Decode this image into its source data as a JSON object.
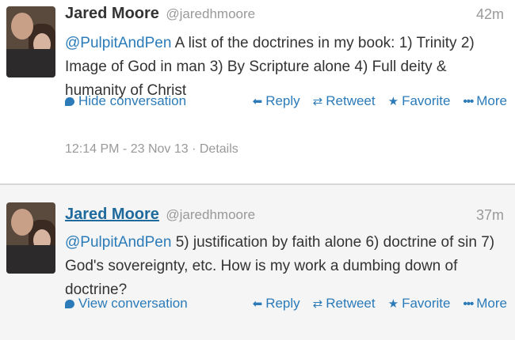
{
  "tweets": [
    {
      "name": "Jared Moore",
      "handle": "@jaredhmoore",
      "time": "42m",
      "mention": "@PulpitAndPen",
      "text": " A list of the doctrines in my book: 1) Trinity 2) Image of God in man 3) By Scripture alone 4) Full deity & humanity of Christ",
      "conversation_label": "Hide conversation",
      "reply_label": "Reply",
      "retweet_label": "Retweet",
      "favorite_label": "Favorite",
      "more_label": "More",
      "timestamp": "12:14 PM - 23 Nov 13",
      "details_label": "Details"
    },
    {
      "name": "Jared Moore",
      "handle": "@jaredhmoore",
      "time": "37m",
      "mention": "@PulpitAndPen",
      "text": " 5) justification by faith alone 6) doctrine of sin 7) God's sovereignty, etc. How is my work a dumbing down of doctrine?",
      "conversation_label": "View conversation",
      "reply_label": "Reply",
      "retweet_label": "Retweet",
      "favorite_label": "Favorite",
      "more_label": "More"
    }
  ],
  "icons": {
    "conversation": "speech-bubble-icon",
    "reply": "reply-arrow-icon",
    "retweet": "retweet-icon",
    "favorite": "star-icon",
    "more": "ellipsis-icon"
  },
  "colors": {
    "link": "#2b7bb9",
    "meta": "#999999",
    "text": "#333333"
  }
}
